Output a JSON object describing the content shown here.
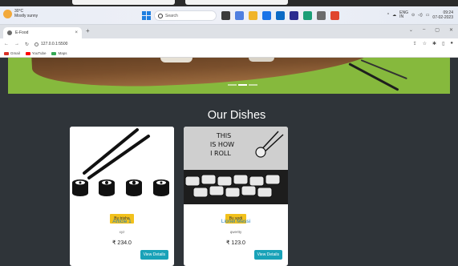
{
  "taskbar": {
    "weather_temp": "30°C",
    "weather_desc": "Mostly sunny",
    "search_placeholder": "Search",
    "tray_lang": "ENG\nIN",
    "clock_time": "09:24",
    "clock_date": "07-02-2023"
  },
  "browser": {
    "tab_title": "E-Food",
    "tab_close": "×",
    "new_tab": "+",
    "url": "127.0.0.1:5500",
    "bookmarks": [
      {
        "label": "Gmail",
        "color": "#d93025"
      },
      {
        "label": "YouTube",
        "color": "#ff0000"
      },
      {
        "label": "Maps",
        "color": "#34a853"
      }
    ]
  },
  "section": {
    "title": "Our Dishes"
  },
  "dishes": [
    {
      "badge": "By trisha",
      "name": "Article 1",
      "description": "xyz",
      "price": "₹ 234.0",
      "button": "View Details"
    },
    {
      "badge": "By sodi",
      "name": "Lionel Messi",
      "description": "qwertty",
      "price": "₹ 123.0",
      "button": "View Details"
    }
  ],
  "dish_image_text": "THIS\nIS HOW\nI ROLL",
  "colors": {
    "page_bg": "#2f3439",
    "badge": "#f2c11c",
    "button": "#19a2b8",
    "hero": "#86b93d"
  }
}
